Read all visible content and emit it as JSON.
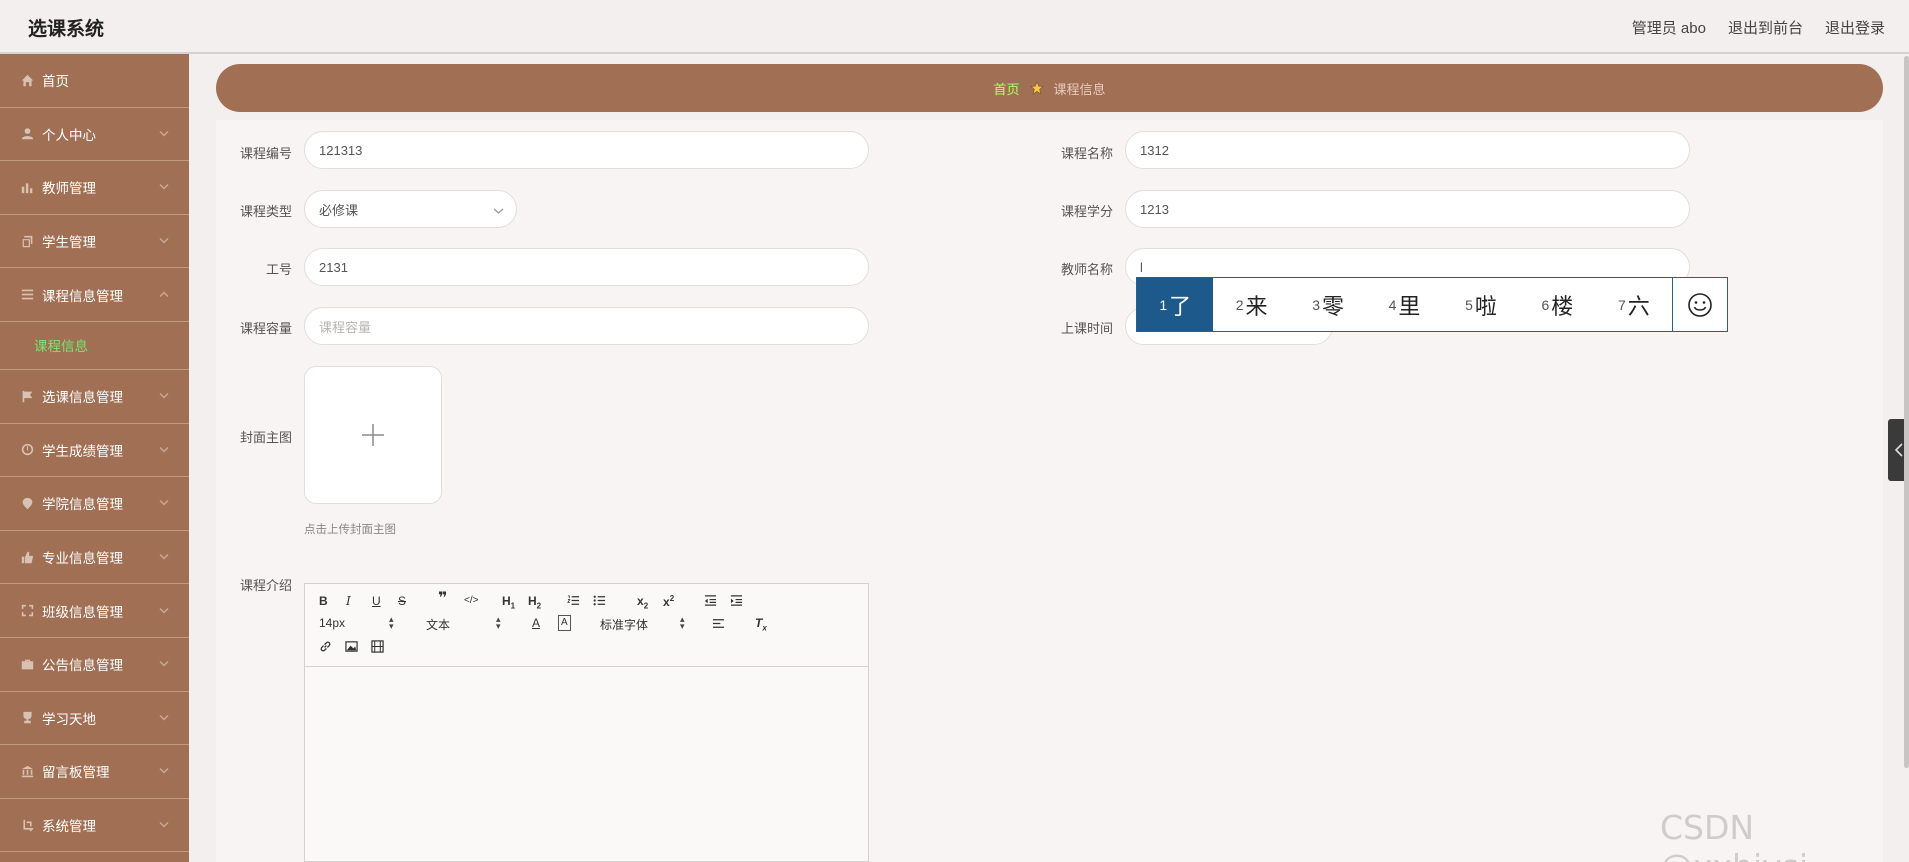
{
  "header": {
    "app_title": "选课系统",
    "user_label": "管理员 abo",
    "front_link": "退出到前台",
    "logout_link": "退出登录"
  },
  "sidebar": {
    "items": [
      {
        "label": "首页",
        "icon": "home-icon"
      },
      {
        "label": "个人中心",
        "icon": "user-icon"
      },
      {
        "label": "教师管理",
        "icon": "bar-chart-icon"
      },
      {
        "label": "学生管理",
        "icon": "copy-icon"
      },
      {
        "label": "课程信息管理",
        "icon": "list-icon"
      },
      {
        "label": "选课信息管理",
        "icon": "flag-icon"
      },
      {
        "label": "学生成绩管理",
        "icon": "clock-icon"
      },
      {
        "label": "学院信息管理",
        "icon": "location-icon"
      },
      {
        "label": "专业信息管理",
        "icon": "thumb-icon"
      },
      {
        "label": "班级信息管理",
        "icon": "fullscreen-icon"
      },
      {
        "label": "公告信息管理",
        "icon": "briefcase-icon"
      },
      {
        "label": "学习天地",
        "icon": "trophy-icon"
      },
      {
        "label": "留言板管理",
        "icon": "bank-icon"
      },
      {
        "label": "系统管理",
        "icon": "crop-icon"
      }
    ],
    "sub_item": "课程信息"
  },
  "breadcrumb": {
    "home": "首页",
    "current": "课程信息"
  },
  "form": {
    "course_no": {
      "label": "课程编号",
      "value": "121313"
    },
    "course_name": {
      "label": "课程名称",
      "value": "1312"
    },
    "course_type": {
      "label": "课程类型",
      "value": "必修课"
    },
    "course_credit": {
      "label": "课程学分",
      "value": "1213"
    },
    "teacher_no": {
      "label": "工号",
      "value": "2131"
    },
    "teacher_name": {
      "label": "教师名称",
      "value": "l"
    },
    "capacity": {
      "label": "课程容量",
      "placeholder": "课程容量"
    },
    "class_time": {
      "label": "上课时间"
    },
    "cover": {
      "label": "封面主图",
      "hint": "点击上传封面主图"
    },
    "intro": {
      "label": "课程介绍"
    }
  },
  "editor": {
    "font_size": "14px",
    "block_type": "文本",
    "font_family": "标准字体"
  },
  "ime": {
    "candidates": [
      {
        "num": "1",
        "text": "了"
      },
      {
        "num": "2",
        "text": "来"
      },
      {
        "num": "3",
        "text": "零"
      },
      {
        "num": "4",
        "text": "里"
      },
      {
        "num": "5",
        "text": "啦"
      },
      {
        "num": "6",
        "text": "楼"
      },
      {
        "num": "7",
        "text": "六"
      }
    ]
  },
  "watermark": "CSDN @xxbiysj"
}
